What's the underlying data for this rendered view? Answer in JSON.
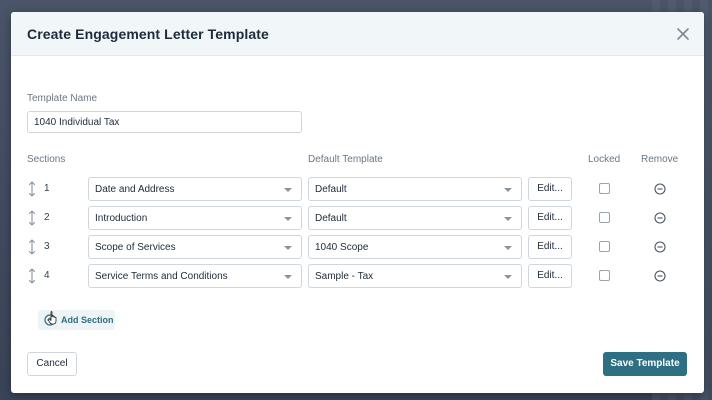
{
  "modal": {
    "title": "Create Engagement Letter Template"
  },
  "template_name": {
    "label": "Template Name",
    "value": "1040 Individual Tax"
  },
  "table": {
    "headers": {
      "sections": "Sections",
      "default_template": "Default Template",
      "locked": "Locked",
      "remove": "Remove"
    },
    "rows": [
      {
        "number": "1",
        "section": "Date and Address",
        "default_template": "Default",
        "edit": "Edit...",
        "locked": false
      },
      {
        "number": "2",
        "section": "Introduction",
        "default_template": "Default",
        "edit": "Edit...",
        "locked": false
      },
      {
        "number": "3",
        "section": "Scope of Services",
        "default_template": "1040 Scope",
        "edit": "Edit...",
        "locked": false
      },
      {
        "number": "4",
        "section": "Service Terms and Conditions",
        "default_template": "Sample - Tax",
        "edit": "Edit...",
        "locked": false
      }
    ]
  },
  "add_section": {
    "label": "Add Section",
    "icon": "plus-circle-icon"
  },
  "footer": {
    "cancel_label": "Cancel",
    "save_label": "Save Template"
  },
  "icons": {
    "close": "close-icon",
    "drag": "drag-handle-icon",
    "remove": "minus-circle-icon",
    "cursor": "hand-pointer-icon"
  },
  "colors": {
    "accent": "#2e6f83",
    "header_bg": "#f1f6f8",
    "title": "#1d2b3a"
  }
}
